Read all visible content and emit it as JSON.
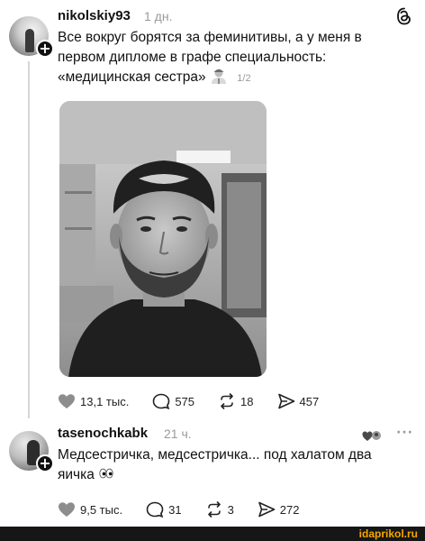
{
  "post": {
    "username": "nikolskiy93",
    "time": "1 дн.",
    "text_line1": "Все вокруг борятся за феминитивы, а у меня в",
    "text_line2": "первом дипломе в графе специальность:",
    "text_line3": "«медицинская сестра»",
    "pager": "1/2",
    "emoji_icon": "health-worker-emoji-icon",
    "likes": "13,1 тыс.",
    "comments": "575",
    "reposts": "18",
    "shares": "457"
  },
  "reply": {
    "username": "tasenochkabk",
    "time": "21 ч.",
    "text_line1": "Медсестричка, медсестричка... под халатом два",
    "text_line2": "яичка",
    "emoji_icon": "eyes-emoji-icon",
    "likes": "9,5 тыс.",
    "comments": "31",
    "reposts": "3",
    "shares": "272"
  },
  "footer": {
    "watermark": "idaprikol.ru",
    "watermark_color": "#f5a600"
  }
}
